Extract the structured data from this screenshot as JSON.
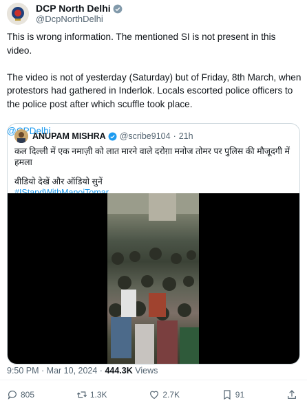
{
  "tweet": {
    "author_name": "DCP North Delhi",
    "author_handle": "@DcpNorthDelhi",
    "paragraph_1": "This is wrong information. The mentioned SI is not present in this video.",
    "paragraph_2": "The video is not of yesterday (Saturday) but of Friday, 8th March, when protestors had gathered in Inderlok. Locals  escorted police officers to the police post after which scuffle took place.",
    "mention": "@CPDelhi",
    "timestamp": "9:50 PM · Mar 10, 2024 · ",
    "views_count": "444.3K",
    "views_label": " Views"
  },
  "quoted": {
    "author_name": "ANUPAM MISHRA",
    "author_handle": "@scribe9104",
    "time": "21h",
    "line_1": "कल दिल्ली में एक नमाज़ी को लात मारने वाले दरोग़ा मनोज तोमर पर पुलिस की मौजूदगी में हमला",
    "line_2": "वीडियो देखें और ऑडियो सुनें",
    "hashtag": "#IStandWithManojTomar"
  },
  "actions": {
    "replies": "805",
    "reposts": "1.3K",
    "likes": "2.7K",
    "bookmarks": "91"
  },
  "colors": {
    "accent": "#1d9bf0",
    "text": "#0f1419",
    "muted": "#536471",
    "border": "#cfd9de"
  }
}
